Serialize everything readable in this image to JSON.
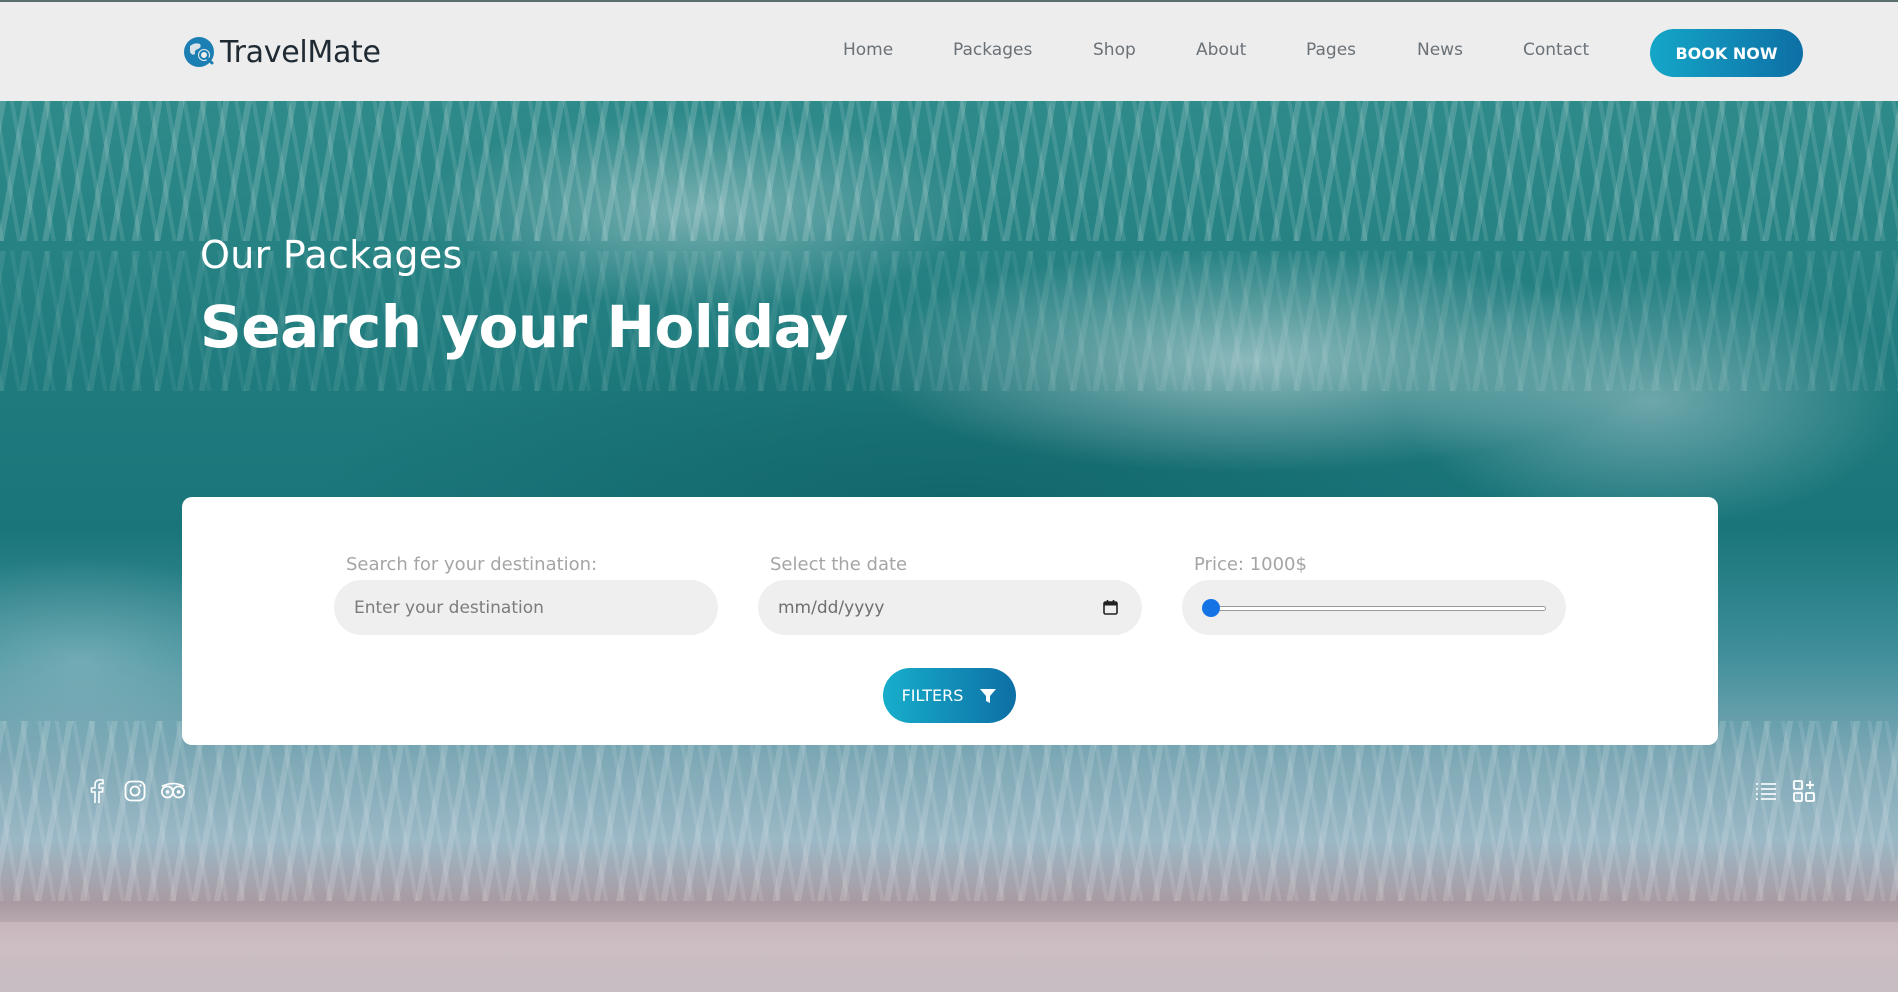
{
  "header": {
    "logo_text": "TravelMate",
    "nav": [
      "Home",
      "Packages",
      "Shop",
      "About",
      "Pages",
      "News",
      "Contact"
    ],
    "book_label": "BOOK NOW"
  },
  "hero": {
    "subtitle": "Our Packages",
    "title": "Search your Holiday"
  },
  "search": {
    "destination_label": "Search for your destination:",
    "destination_placeholder": "Enter your destination",
    "date_label": "Select the date",
    "date_placeholder": "mm/dd/yyyy",
    "price_label": "Price: 1000$",
    "price_slider_fraction": 0,
    "filters_label": "FILTERS"
  },
  "social_icons": [
    "facebook-icon",
    "instagram-icon",
    "tripadvisor-icon"
  ],
  "view_icons": [
    "list-view-icon",
    "grid-view-icon"
  ],
  "colors": {
    "accent_start": "#15a6c8",
    "accent_end": "#0d6fa5",
    "slider_thumb": "#1673e6"
  }
}
